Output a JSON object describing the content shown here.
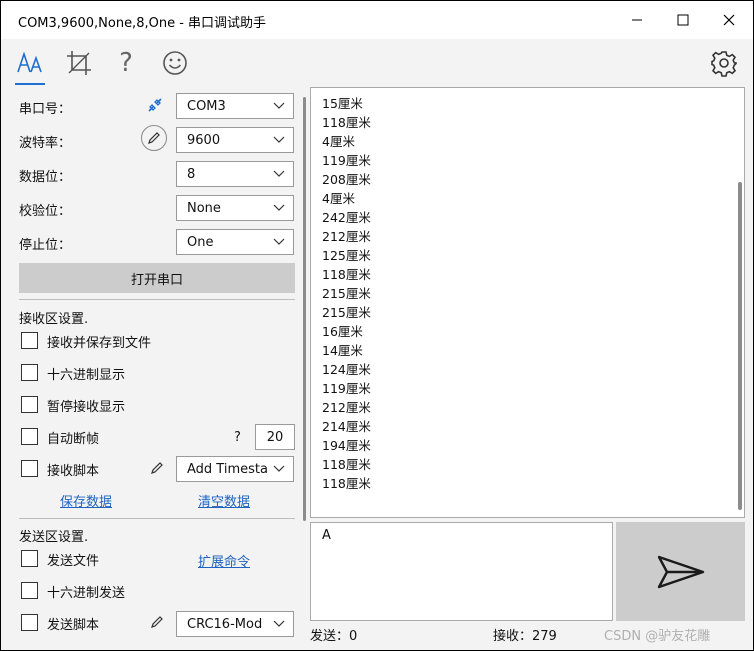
{
  "window": {
    "title": "COM3,9600,None,8,One - 串口调试助手"
  },
  "toolbar": {
    "icons": [
      "font-icon",
      "crop-icon",
      "help-icon",
      "smiley-icon",
      "gear-icon"
    ],
    "help_glyph": "?"
  },
  "serial": {
    "port_label": "串口号：",
    "port_value": "COM3",
    "baud_label": "波特率：",
    "baud_value": "9600",
    "databits_label": "数据位：",
    "databits_value": "8",
    "parity_label": "校验位：",
    "parity_value": "None",
    "stopbits_label": "停止位：",
    "stopbits_value": "One",
    "open_button": "打开串口"
  },
  "receive_settings": {
    "heading": "接收区设置.",
    "save_to_file": "接收并保存到文件",
    "hex_display": "十六进制显示",
    "pause_display": "暂停接收显示",
    "auto_frame": "自动断帧",
    "auto_frame_help": "?",
    "auto_frame_value": "20",
    "script": "接收脚本",
    "script_value": "Add Timesta",
    "save_data": "保存数据",
    "clear_data": "清空数据"
  },
  "send_settings": {
    "heading": "发送区设置.",
    "send_file": "发送文件",
    "extend_cmd": "扩展命令",
    "hex_send": "十六进制发送",
    "script": "发送脚本",
    "script_value": "CRC16-Mod"
  },
  "receive_area": {
    "lines": [
      "15厘米",
      "118厘米",
      "4厘米",
      "119厘米",
      "208厘米",
      "4厘米",
      "242厘米",
      "212厘米",
      "125厘米",
      "118厘米",
      "215厘米",
      "215厘米",
      "16厘米",
      "14厘米",
      "124厘米",
      "119厘米",
      "212厘米",
      "214厘米",
      "194厘米",
      "118厘米",
      "118厘米"
    ]
  },
  "send_area": {
    "text": "A"
  },
  "status": {
    "sent": "发送：0",
    "received": "接收：279",
    "watermark": "CSDN @驴友花雕"
  },
  "colors": {
    "accent": "#1e6fd0",
    "link": "#1e63c0",
    "button_bg": "#cccccc"
  }
}
